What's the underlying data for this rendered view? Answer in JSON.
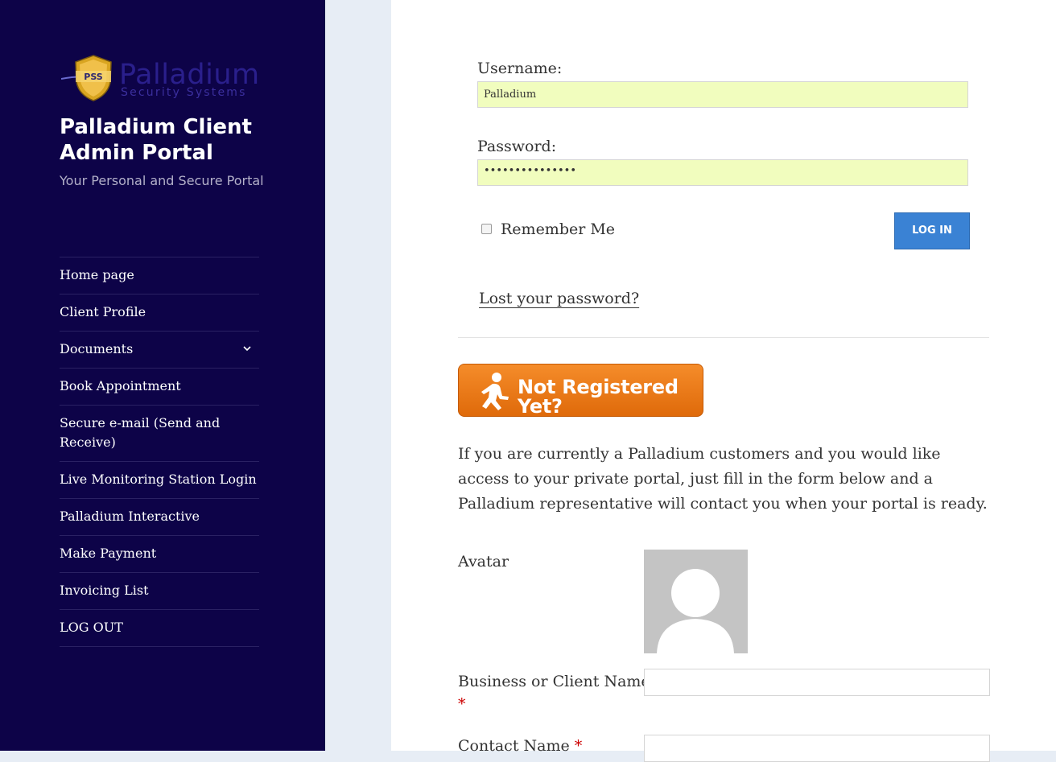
{
  "sidebar": {
    "logo_word": "Palladium",
    "logo_sub": "Security Systems",
    "logo_badge": "PSS",
    "site_title": "Palladium Client Admin Portal",
    "tagline": "Your Personal and Secure Portal",
    "nav": [
      {
        "label": "Home page"
      },
      {
        "label": "Client Profile"
      },
      {
        "label": "Documents"
      },
      {
        "label": "Book Appointment"
      },
      {
        "label": "Secure e-mail (Send and Receive)"
      },
      {
        "label": "Live Monitoring Station Login"
      },
      {
        "label": "Palladium Interactive"
      },
      {
        "label": "Make Payment"
      },
      {
        "label": "Invoicing List"
      },
      {
        "label": "LOG OUT"
      }
    ]
  },
  "login": {
    "username_label": "Username:",
    "username_value": "Palladium",
    "password_label": "Password:",
    "password_value": "•••••••••••••••",
    "remember_label": "Remember Me",
    "login_button": "LOG IN",
    "lost_password": "Lost your password?"
  },
  "register": {
    "button_text": "Not Registered Yet?",
    "intro": "If you are currently a Palladium customers and you would like access to your private portal, just fill in the form below and a Palladium representative will contact you when your portal is ready.",
    "avatar_label": "Avatar",
    "business_label": "Business or Client Name",
    "contact_label": "Contact Name",
    "required_mark": "*"
  },
  "colors": {
    "sidebar_bg": "#0d0348",
    "login_button": "#3a82d4",
    "register_button": "#f07d1a",
    "autofill_bg": "#f1fdbe"
  }
}
